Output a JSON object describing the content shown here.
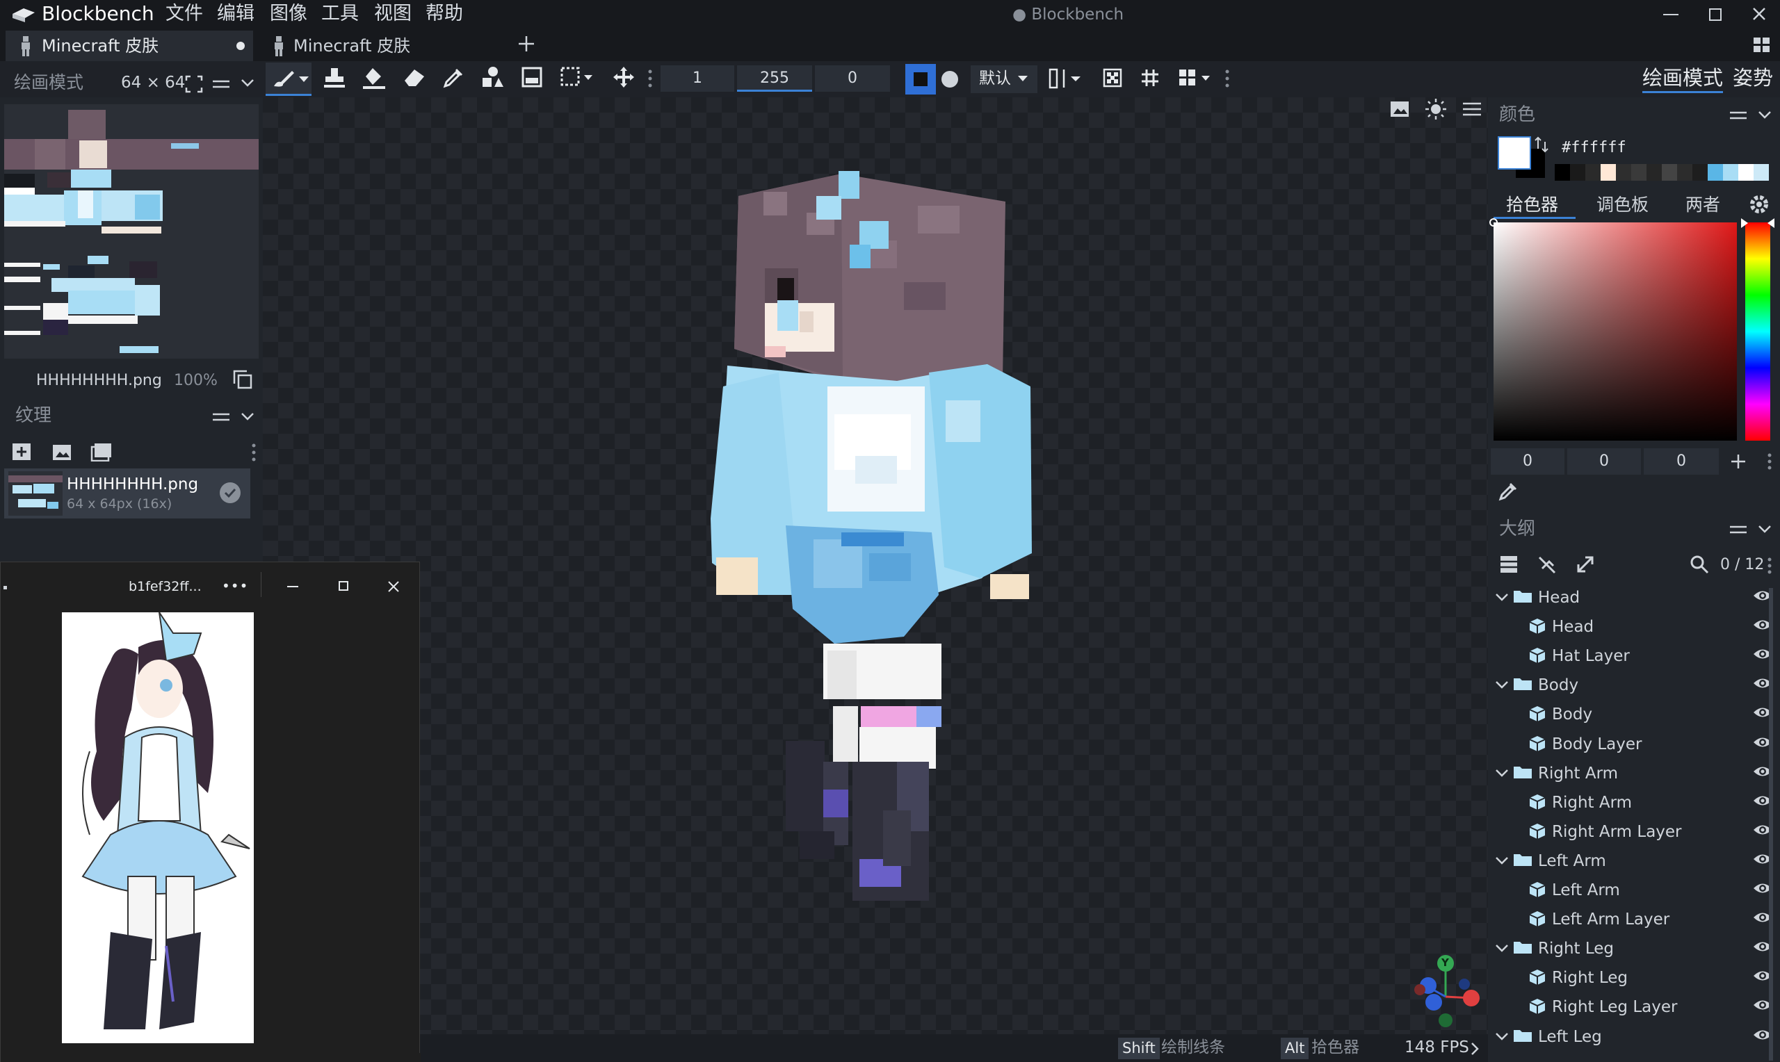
{
  "app": {
    "name": "Blockbench",
    "window_title": "● Blockbench"
  },
  "menu": [
    "文件",
    "编辑",
    "图像",
    "工具",
    "视图",
    "帮助"
  ],
  "tabs": [
    {
      "label": "Minecraft 皮肤",
      "active": true
    },
    {
      "label": "Minecraft 皮肤",
      "active": false
    }
  ],
  "toolbar": {
    "brush_size": "1",
    "opacity": "255",
    "softness": "0",
    "blend_mode": "默认"
  },
  "modes": {
    "paint": "绘画模式",
    "pose": "姿势"
  },
  "left": {
    "panel_title": "绘画模式",
    "canvas_size": "64 × 64",
    "texture_file": "HHHHHHHH.png",
    "zoom": "100%",
    "textures_title": "纹理",
    "texture_item": {
      "name": "HHHHHHHH.png",
      "meta": "64 x 64px (16x)"
    }
  },
  "refwin": {
    "title": "b1fef32ff...",
    "more": "•••"
  },
  "color": {
    "title": "颜色",
    "hex": "#ffffff",
    "tabs": [
      "拾色器",
      "调色板",
      "两者"
    ],
    "rgb": [
      "0",
      "0",
      "0"
    ],
    "palette": [
      "#000000",
      "#1a1a1a",
      "#2a2a2a",
      "#ffe8d6",
      "#2e2e2e",
      "#3a3a3a",
      "#262626",
      "#444444",
      "#2c2c2c",
      "#1e1e1e",
      "#5ab6e6",
      "#a8ddf5",
      "#ffffff",
      "#cde9f7"
    ]
  },
  "outliner": {
    "title": "大纲",
    "count": "0 / 12",
    "items": [
      {
        "label": "Head",
        "type": "group"
      },
      {
        "label": "Head",
        "type": "cube"
      },
      {
        "label": "Hat Layer",
        "type": "cube"
      },
      {
        "label": "Body",
        "type": "group"
      },
      {
        "label": "Body",
        "type": "cube"
      },
      {
        "label": "Body Layer",
        "type": "cube"
      },
      {
        "label": "Right Arm",
        "type": "group"
      },
      {
        "label": "Right Arm",
        "type": "cube"
      },
      {
        "label": "Right Arm Layer",
        "type": "cube"
      },
      {
        "label": "Left Arm",
        "type": "group"
      },
      {
        "label": "Left Arm",
        "type": "cube"
      },
      {
        "label": "Left Arm Layer",
        "type": "cube"
      },
      {
        "label": "Right Leg",
        "type": "group"
      },
      {
        "label": "Right Leg",
        "type": "cube"
      },
      {
        "label": "Right Leg Layer",
        "type": "cube"
      },
      {
        "label": "Left Leg",
        "type": "group"
      }
    ]
  },
  "status": {
    "shift_key": "Shift",
    "shift_action": "绘制线条",
    "alt_key": "Alt",
    "alt_action": "拾色器",
    "fps": "148 FPS"
  },
  "gizmo": {
    "y": "Y"
  },
  "colors": {
    "accent": "#3b82d6",
    "bg": "#21252b",
    "viewport": "#1e2126"
  }
}
